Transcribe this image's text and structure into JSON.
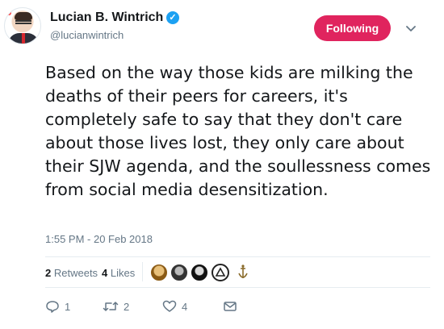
{
  "user": {
    "name": "Lucian B. Wintrich",
    "handle": "@lucianwintrich",
    "verified": true
  },
  "follow_button": {
    "label": "Following",
    "color": "#e0245e"
  },
  "tweet": {
    "text": "Based on the way those kids are milking the deaths of their peers for careers, it's completely safe to say that they don't care about those lives lost, they only care about their SJW agenda, and the soullessness comes from social media desensitization.",
    "timestamp": "1:55 PM - 20 Feb 2018"
  },
  "stats": {
    "retweets_count": "2",
    "retweets_label": "Retweets",
    "likes_count": "4",
    "likes_label": "Likes"
  },
  "actions": {
    "reply_count": "1",
    "retweet_count": "2",
    "like_count": "4"
  },
  "icons": [
    "verified-badge-icon",
    "chevron-down-icon",
    "reply-icon",
    "retweet-icon",
    "heart-icon",
    "direct-message-icon"
  ],
  "colors": {
    "text": "#14171a",
    "secondary": "#657786",
    "verified": "#1da1f2"
  }
}
